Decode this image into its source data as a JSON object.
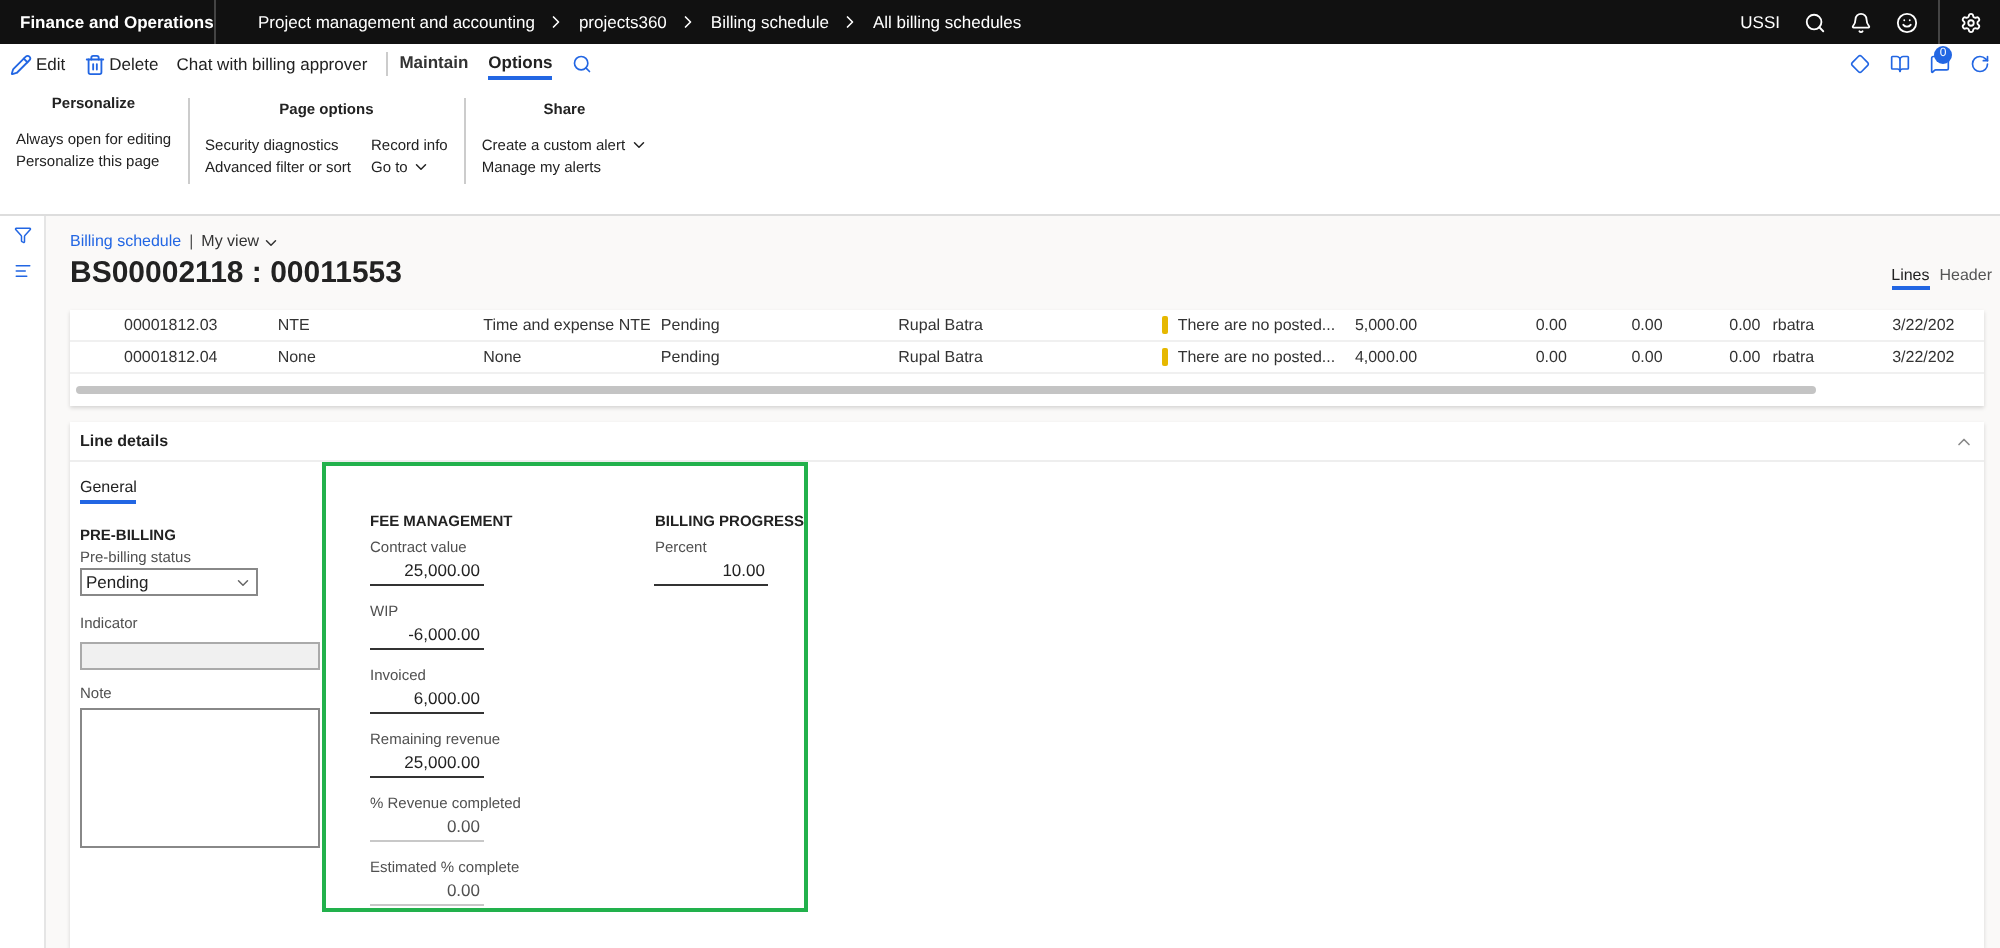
{
  "top_bar": {
    "app_name": "Finance and Operations",
    "breadcrumbs": [
      "Project management and accounting",
      "projects360",
      "Billing schedule",
      "All billing schedules"
    ],
    "company": "USSI",
    "notification_count": "0"
  },
  "action_bar": {
    "actions": [
      {
        "kind": "edit",
        "label": "Edit"
      },
      {
        "kind": "delete",
        "label": "Delete"
      },
      {
        "kind": "text",
        "label": "Chat with billing approver"
      }
    ],
    "tabs": [
      {
        "label": "Maintain",
        "selected": false
      },
      {
        "label": "Options",
        "selected": true
      }
    ]
  },
  "ribbon": [
    {
      "title": "Personalize",
      "columns": [
        [
          {
            "label": "Always open for editing",
            "dropdown": false
          },
          {
            "label": "Personalize this page",
            "dropdown": false
          }
        ]
      ]
    },
    {
      "title": "Page options",
      "columns": [
        [
          {
            "label": "Security diagnostics",
            "dropdown": false
          },
          {
            "label": "Advanced filter or sort",
            "dropdown": false
          }
        ],
        [
          {
            "label": "Record info",
            "dropdown": false
          },
          {
            "label": "Go to",
            "dropdown": true
          }
        ]
      ]
    },
    {
      "title": "Share",
      "columns": [
        [
          {
            "label": "Create a custom alert",
            "dropdown": true
          },
          {
            "label": "Manage my alerts",
            "dropdown": false
          }
        ]
      ]
    }
  ],
  "page": {
    "breadcrumb": "Billing schedule",
    "separator": "|",
    "view": "My view",
    "title": "BS00002118 : 00011553",
    "view_tabs": [
      {
        "label": "Lines",
        "selected": true
      },
      {
        "label": "Header",
        "selected": false
      }
    ]
  },
  "grid": {
    "rows": [
      {
        "cells": [
          "00001812.03",
          "NTE",
          "Time and expense NTE",
          "Pending",
          "Rupal Batra",
          "There are no posted...",
          "5,000.00",
          "0.00",
          "0.00",
          "0.00",
          "rbatra",
          "3/22/202"
        ],
        "warning": true
      },
      {
        "cells": [
          "00001812.04",
          "None",
          "None",
          "Pending",
          "Rupal Batra",
          "There are no posted...",
          "4,000.00",
          "0.00",
          "0.00",
          "0.00",
          "rbatra",
          "3/22/202"
        ],
        "warning": true
      }
    ]
  },
  "line_details": {
    "title": "Line details",
    "expanded": true,
    "tabs": [
      {
        "label": "General",
        "selected": true
      }
    ],
    "pre_billing": {
      "heading": "PRE-BILLING",
      "status_label": "Pre-billing status",
      "status_value": "Pending",
      "indicator_label": "Indicator",
      "note_label": "Note"
    },
    "fee_management": {
      "heading": "FEE MANAGEMENT",
      "fields": [
        {
          "label": "Contract value",
          "value": "25,000.00",
          "read_only": false
        },
        {
          "label": "WIP",
          "value": "-6,000.00",
          "read_only": false
        },
        {
          "label": "Invoiced",
          "value": "6,000.00",
          "read_only": false
        },
        {
          "label": "Remaining revenue",
          "value": "25,000.00",
          "read_only": false
        },
        {
          "label": "% Revenue completed",
          "value": "0.00",
          "read_only": true
        },
        {
          "label": "Estimated % complete",
          "value": "0.00",
          "read_only": true
        }
      ]
    },
    "billing_progress": {
      "heading": "BILLING PROGRESS",
      "fields": [
        {
          "label": "Percent",
          "value": "10.00",
          "read_only": false
        }
      ]
    }
  }
}
